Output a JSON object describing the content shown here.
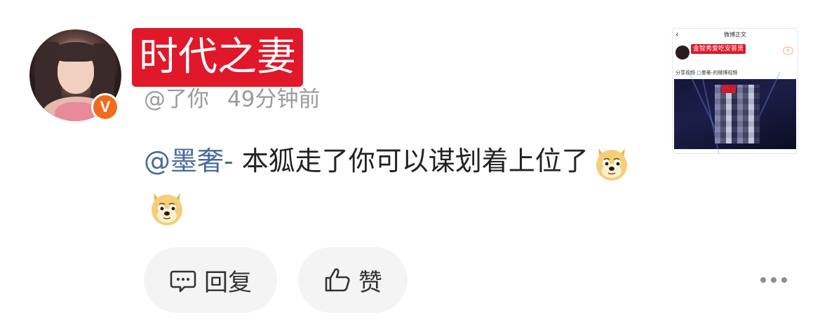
{
  "user": {
    "name": "时代之妻",
    "handle": "@了你",
    "time": "49分钟前",
    "verified_badge": "V"
  },
  "comment": {
    "mention": "@墨奢-",
    "text": " 本狐走了你可以谋划着上位了",
    "emojis": [
      "doge-icon",
      "doge-icon"
    ]
  },
  "thumbnail": {
    "header_title": "微博正文",
    "poster_name": "金智秀爱吃安普贤",
    "caption": "分享视频 □墨奢-的微博视频"
  },
  "actions": {
    "reply_label": "回复",
    "like_label": "赞"
  },
  "colors": {
    "name_tag_bg": "#e0182a",
    "badge": "#f26b1d",
    "mention": "#4a6a99",
    "pill_bg": "#f4f4f4"
  }
}
